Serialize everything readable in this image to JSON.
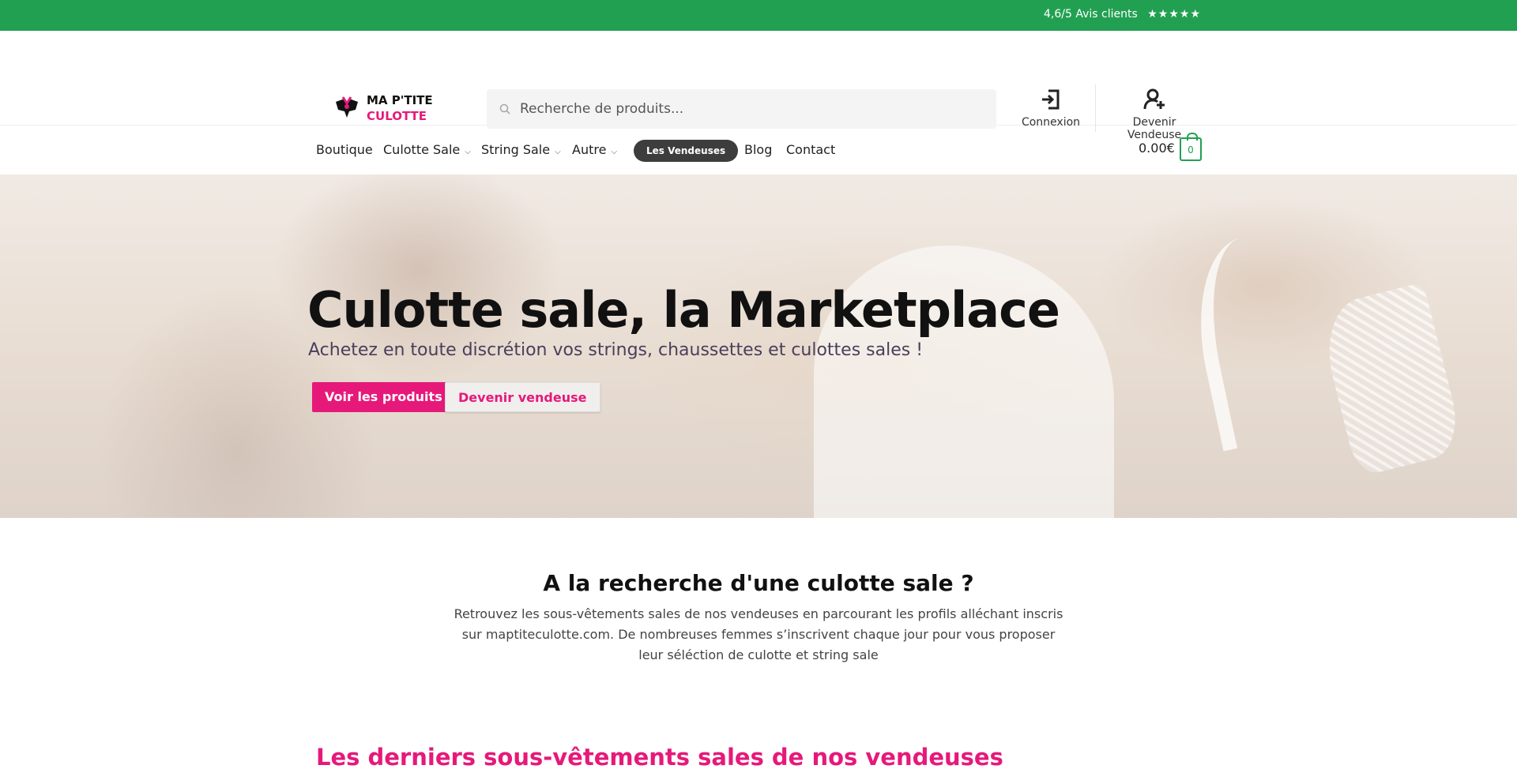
{
  "topbar": {
    "reviews_text": "4,6/5 Avis clients",
    "stars": "★★★★★",
    "bg_color": "#22a052"
  },
  "header": {
    "logo": {
      "line1": "MA P'TITE",
      "line2": "CULOTTE"
    },
    "search": {
      "placeholder": "Recherche de produits...",
      "value": ""
    },
    "login_label": "Connexion",
    "seller_label": "Devenir Vendeuse"
  },
  "nav": {
    "items": [
      {
        "label": "Boutique"
      },
      {
        "label": "Culotte Sale"
      },
      {
        "label": "String Sale"
      },
      {
        "label": "Autre"
      },
      {
        "label": "Les Vendeuses"
      },
      {
        "label": "Blog"
      },
      {
        "label": "Contact"
      }
    ],
    "cart_total": "0.00€",
    "cart_count": "0"
  },
  "hero": {
    "title": "Culotte sale, la Marketplace",
    "subtitle": "Achetez en toute discrétion vos strings, chaussettes et culottes sales !",
    "primary_button": "Voir les produits",
    "secondary_button": "Devenir vendeuse"
  },
  "intro": {
    "heading": "A la recherche d'une culotte sale ?",
    "text": "Retrouvez les sous-vêtements sales de nos vendeuses en parcourant les profils alléchant inscris sur maptiteculotte.com. De nombreuses femmes s’inscrivent chaque jour pour vous proposer leur séléction de culotte et string sale"
  },
  "latest": {
    "heading": "Les derniers sous-vêtements sales de nos vendeuses"
  },
  "colors": {
    "accent": "#e6197a",
    "green": "#22a052",
    "dark": "#3d3d3d"
  }
}
